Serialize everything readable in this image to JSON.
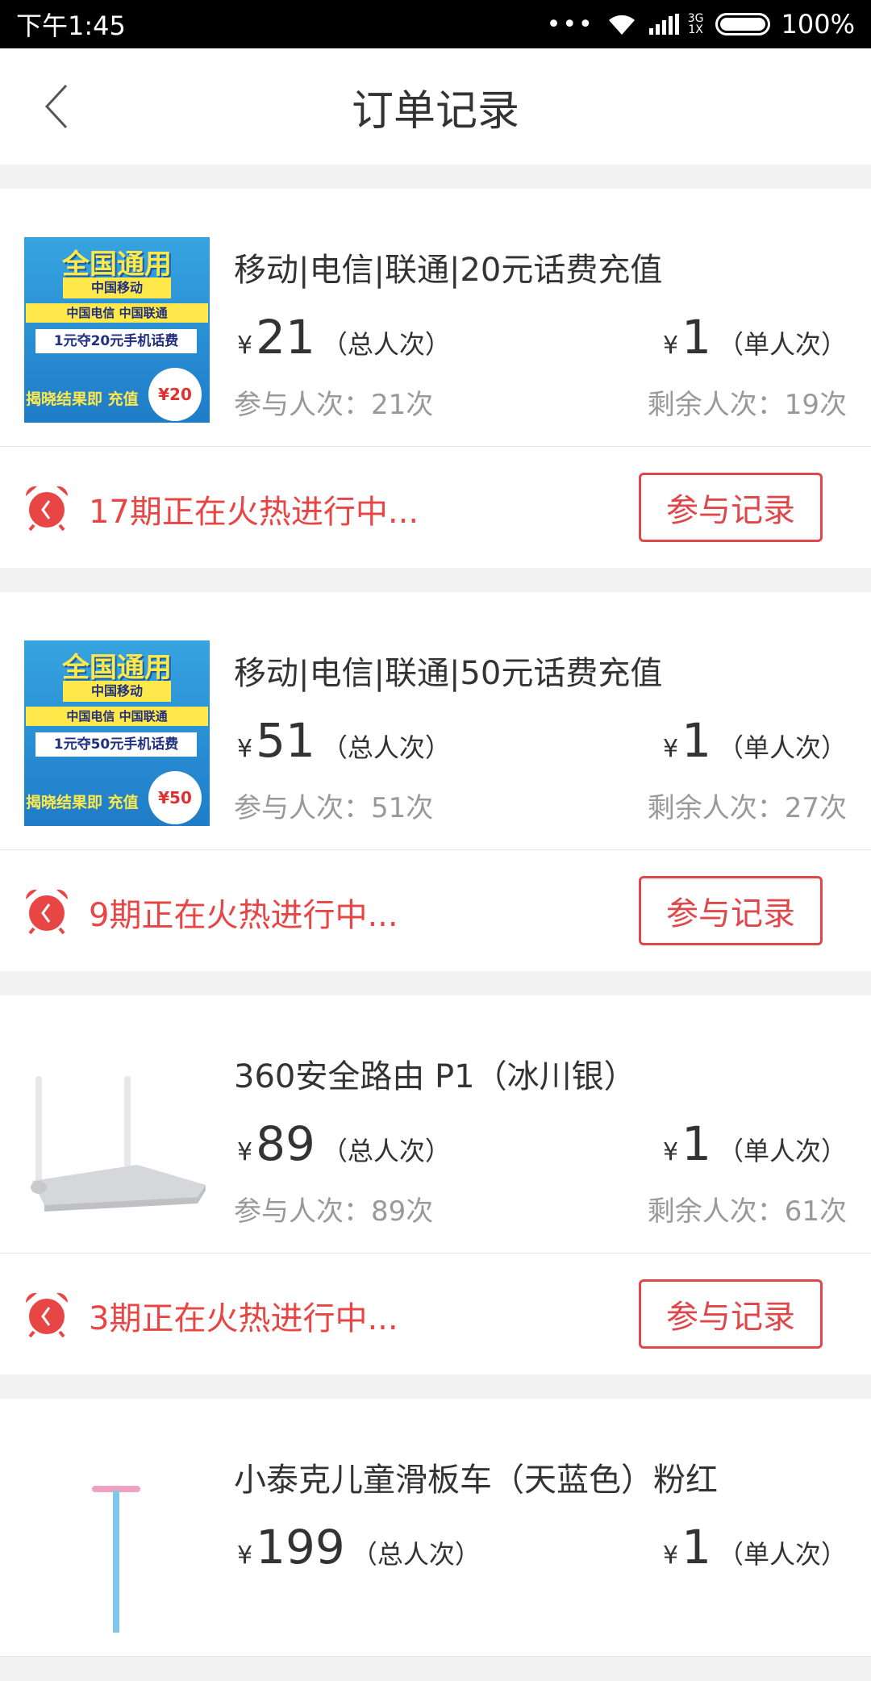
{
  "status_bar": {
    "time": "下午1:45",
    "dots": "•••",
    "net_top": "3G",
    "net_bottom": "1X",
    "battery": "100%"
  },
  "header": {
    "title": "订单记录"
  },
  "labels": {
    "yen": "¥",
    "total_unit": "（总人次）",
    "single_unit": "（单人次）",
    "record_button": "参与记录"
  },
  "orders": [
    {
      "name": "移动|电信|联通|20元话费充值",
      "total": "21",
      "single": "1",
      "participated": "参与人次：21次",
      "remaining": "剩余人次：19次",
      "status": "17期正在火热进行中...",
      "thumb": {
        "type": "recharge",
        "t1": "全国通用",
        "t2": "中国移动",
        "t3": "中国电信 中国联通",
        "t4": "1元夺20元手机话费",
        "t5": "揭晓结果即 充值",
        "burst": "¥20"
      }
    },
    {
      "name": "移动|电信|联通|50元话费充值",
      "total": "51",
      "single": "1",
      "participated": "参与人次：51次",
      "remaining": "剩余人次：27次",
      "status": "9期正在火热进行中...",
      "thumb": {
        "type": "recharge",
        "t1": "全国通用",
        "t2": "中国移动",
        "t3": "中国电信 中国联通",
        "t4": "1元夺50元手机话费",
        "t5": "揭晓结果即 充值",
        "burst": "¥50"
      }
    },
    {
      "name": "360安全路由 P1（冰川银）",
      "total": "89",
      "single": "1",
      "participated": "参与人次：89次",
      "remaining": "剩余人次：61次",
      "status": "3期正在火热进行中...",
      "thumb": {
        "type": "router"
      }
    },
    {
      "name": "小泰克儿童滑板车（天蓝色）粉红",
      "total": "199",
      "single": "1",
      "thumb": {
        "type": "scooter"
      }
    }
  ],
  "colors": {
    "accent": "#e84545",
    "muted": "#999999",
    "text": "#333333"
  },
  "icons": {
    "back": "chevron-left-icon",
    "alarm": "alarm-clock-icon"
  }
}
